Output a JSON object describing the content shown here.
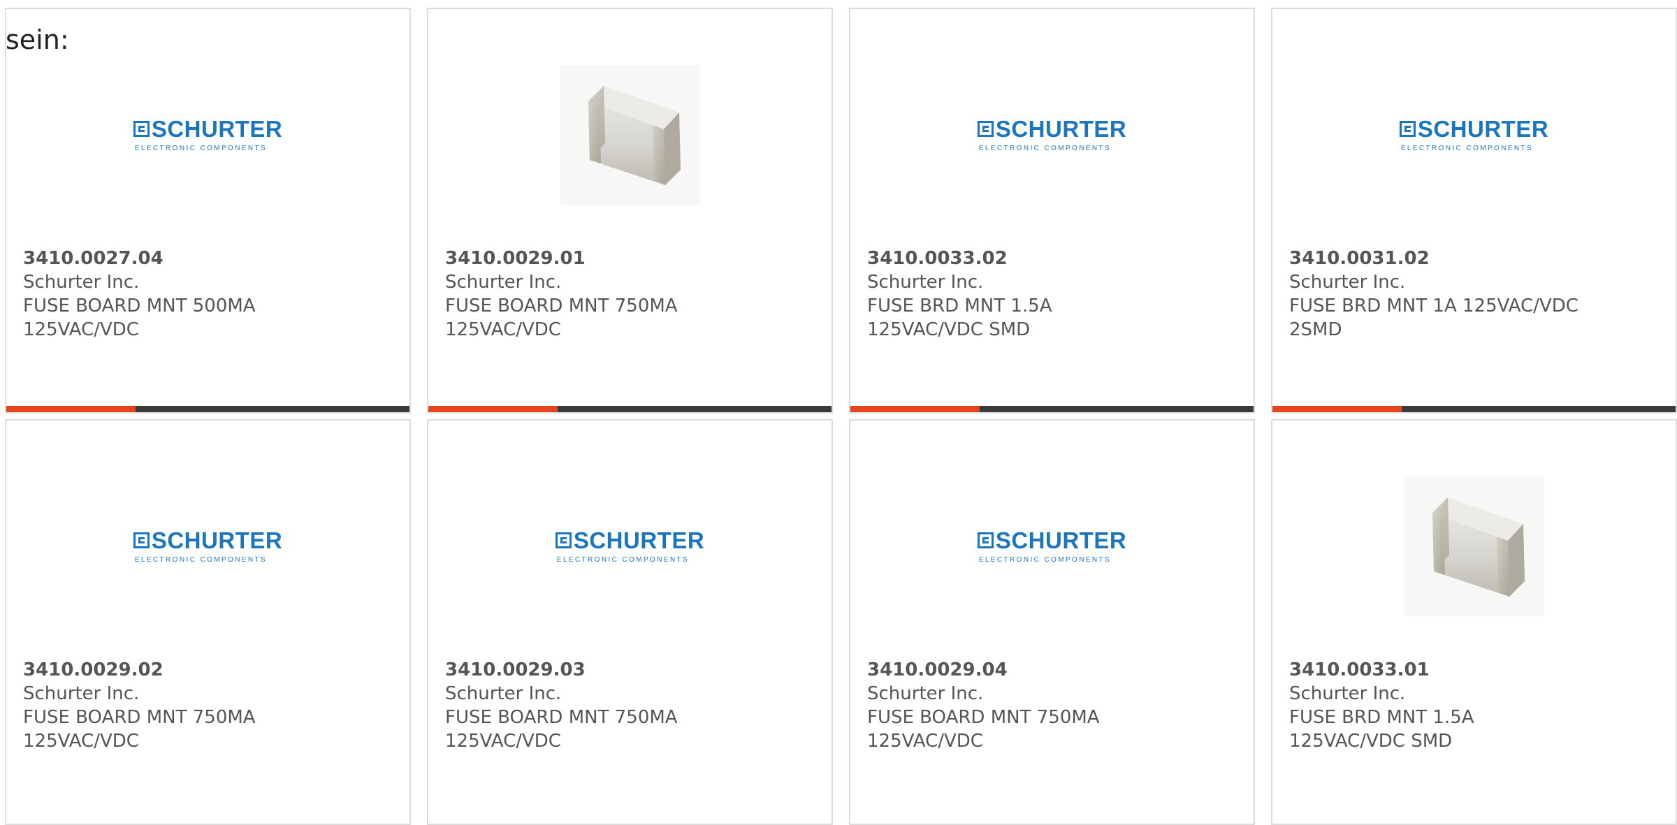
{
  "intro_text": "sein:",
  "accent_color": "#e8441b",
  "brand_color": "#1b76bd",
  "logo": {
    "name": "SCHURTER",
    "tagline": "ELECTRONIC COMPONENTS"
  },
  "products": [
    {
      "part_number": "3410.0027.04",
      "manufacturer": "Schurter Inc.",
      "description_line1": "FUSE BOARD MNT 500MA",
      "description_line2": "125VAC/VDC",
      "image": "schurter-logo",
      "bar_progress": 0.32
    },
    {
      "part_number": "3410.0029.01",
      "manufacturer": "Schurter Inc.",
      "description_line1": "FUSE BOARD MNT 750MA",
      "description_line2": "125VAC/VDC",
      "image": "fuse-photo",
      "bar_progress": 0.32
    },
    {
      "part_number": "3410.0033.02",
      "manufacturer": "Schurter Inc.",
      "description_line1": "FUSE BRD MNT 1.5A",
      "description_line2": "125VAC/VDC SMD",
      "image": "schurter-logo",
      "bar_progress": 0.32
    },
    {
      "part_number": "3410.0031.02",
      "manufacturer": "Schurter Inc.",
      "description_line1": "FUSE BRD MNT 1A 125VAC/VDC",
      "description_line2": "2SMD",
      "image": "schurter-logo",
      "bar_progress": 0.32
    },
    {
      "part_number": "3410.0029.02",
      "manufacturer": "Schurter Inc.",
      "description_line1": "FUSE BOARD MNT 750MA",
      "description_line2": "125VAC/VDC",
      "image": "schurter-logo"
    },
    {
      "part_number": "3410.0029.03",
      "manufacturer": "Schurter Inc.",
      "description_line1": "FUSE BOARD MNT 750MA",
      "description_line2": "125VAC/VDC",
      "image": "schurter-logo"
    },
    {
      "part_number": "3410.0029.04",
      "manufacturer": "Schurter Inc.",
      "description_line1": "FUSE BOARD MNT 750MA",
      "description_line2": "125VAC/VDC",
      "image": "schurter-logo"
    },
    {
      "part_number": "3410.0033.01",
      "manufacturer": "Schurter Inc.",
      "description_line1": "FUSE BRD MNT 1.5A",
      "description_line2": "125VAC/VDC SMD",
      "image": "fuse-photo"
    }
  ]
}
